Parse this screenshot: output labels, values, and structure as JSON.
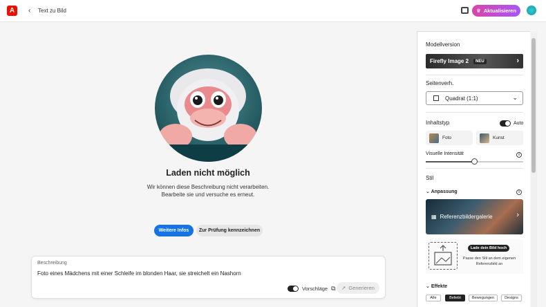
{
  "topbar": {
    "back_label": "‹",
    "breadcrumb": "Text zu Bild",
    "upgrade_label": "Aktualisieren"
  },
  "stage": {
    "headline": "Laden nicht möglich",
    "subtext_line1": "Wir können diese Beschreibung nicht verarbeiten.",
    "subtext_line2": "Bearbeite sie und versuche es erneut.",
    "btn_info": "Weitere Infos",
    "btn_review": "Zur Prüfung kennzeichnen"
  },
  "prompt": {
    "label": "Beschreibung",
    "text": "Foto eines Mädchens mit einer Schleife im blonden Haar, sie streichelt ein Nashorn",
    "suggestions_label": "Vorschläge",
    "generate_label": "Generieren"
  },
  "panel": {
    "model_heading": "Modellversion",
    "model_name": "Firefly Image 2",
    "model_badge": "NEU",
    "aspect_heading": "Seitenverh.",
    "aspect_value": "Quadrat (1:1)",
    "content_heading": "Inhaltstyp",
    "content_auto": "Auto",
    "content_photo": "Foto",
    "content_art": "Kunst",
    "intensity_label": "Visuelle Intensität",
    "intensity_level": 0.5,
    "style_heading": "Stil",
    "match_heading": "Anpassung",
    "gallery_label": "Referenzbildergalerie",
    "upload_button": "Lade dein Bild hoch",
    "upload_text": "Passe den Stil an dem eigenen Referenzbild an",
    "effects_heading": "Effekte",
    "effect_chips": [
      "Alle",
      "Beliebt",
      "Bewegungen",
      "Designs"
    ]
  }
}
